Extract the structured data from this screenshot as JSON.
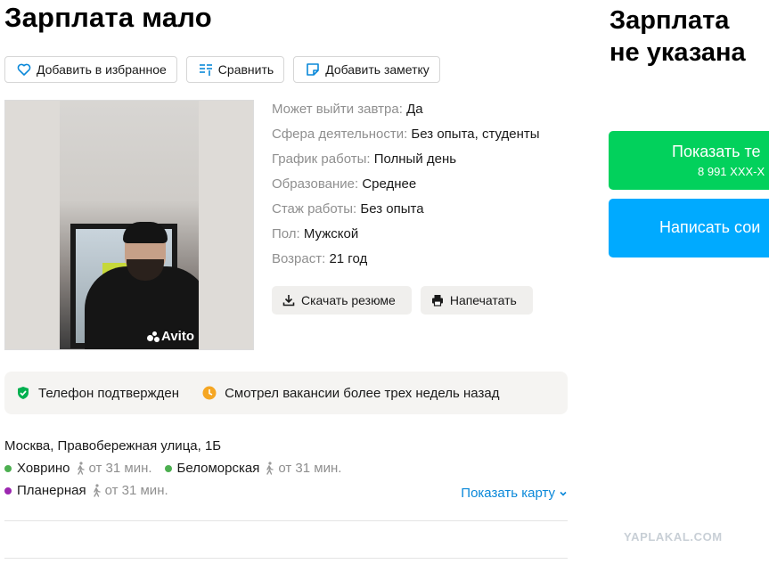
{
  "title": "Зарплата мало",
  "actions": {
    "favorite": "Добавить в избранное",
    "compare": "Сравнить",
    "note": "Добавить заметку"
  },
  "photo": {
    "watermark": "Avito"
  },
  "params": [
    {
      "key": "Может выйти завтра:",
      "value": "Да"
    },
    {
      "key": "Сфера деятельности:",
      "value": "Без опыта, студенты"
    },
    {
      "key": "График работы:",
      "value": "Полный день"
    },
    {
      "key": "Образование:",
      "value": "Среднее"
    },
    {
      "key": "Стаж работы:",
      "value": "Без опыта"
    },
    {
      "key": "Пол:",
      "value": "Мужской"
    },
    {
      "key": "Возраст:",
      "value": "21 год"
    }
  ],
  "docs": {
    "download": "Скачать резюме",
    "print": "Напечатать"
  },
  "badges": {
    "phone_verified": "Телефон подтвержден",
    "viewed": "Смотрел вакансии более трех недель назад"
  },
  "location": {
    "address": "Москва, Правобережная улица, 1Б",
    "metro": [
      {
        "name": "Ховрино",
        "time": "от 31 мин.",
        "color": "#4caf50"
      },
      {
        "name": "Беломорская",
        "time": "от 31 мин.",
        "color": "#4caf50"
      },
      {
        "name": "Планерная",
        "time": "от 31 мин.",
        "color": "#9c27b0"
      }
    ],
    "show_map": "Показать карту"
  },
  "sidebar": {
    "salary_line1": "Зарплата",
    "salary_line2": "не указана",
    "phone_button": "Показать те",
    "phone_number": "8 991 ХХХ-Х",
    "message_button": "Написать сои"
  },
  "colors": {
    "green": "#02d15c",
    "blue": "#00aaff",
    "link": "#0a88d9"
  },
  "watermark": "YAPLAKAL.COM"
}
